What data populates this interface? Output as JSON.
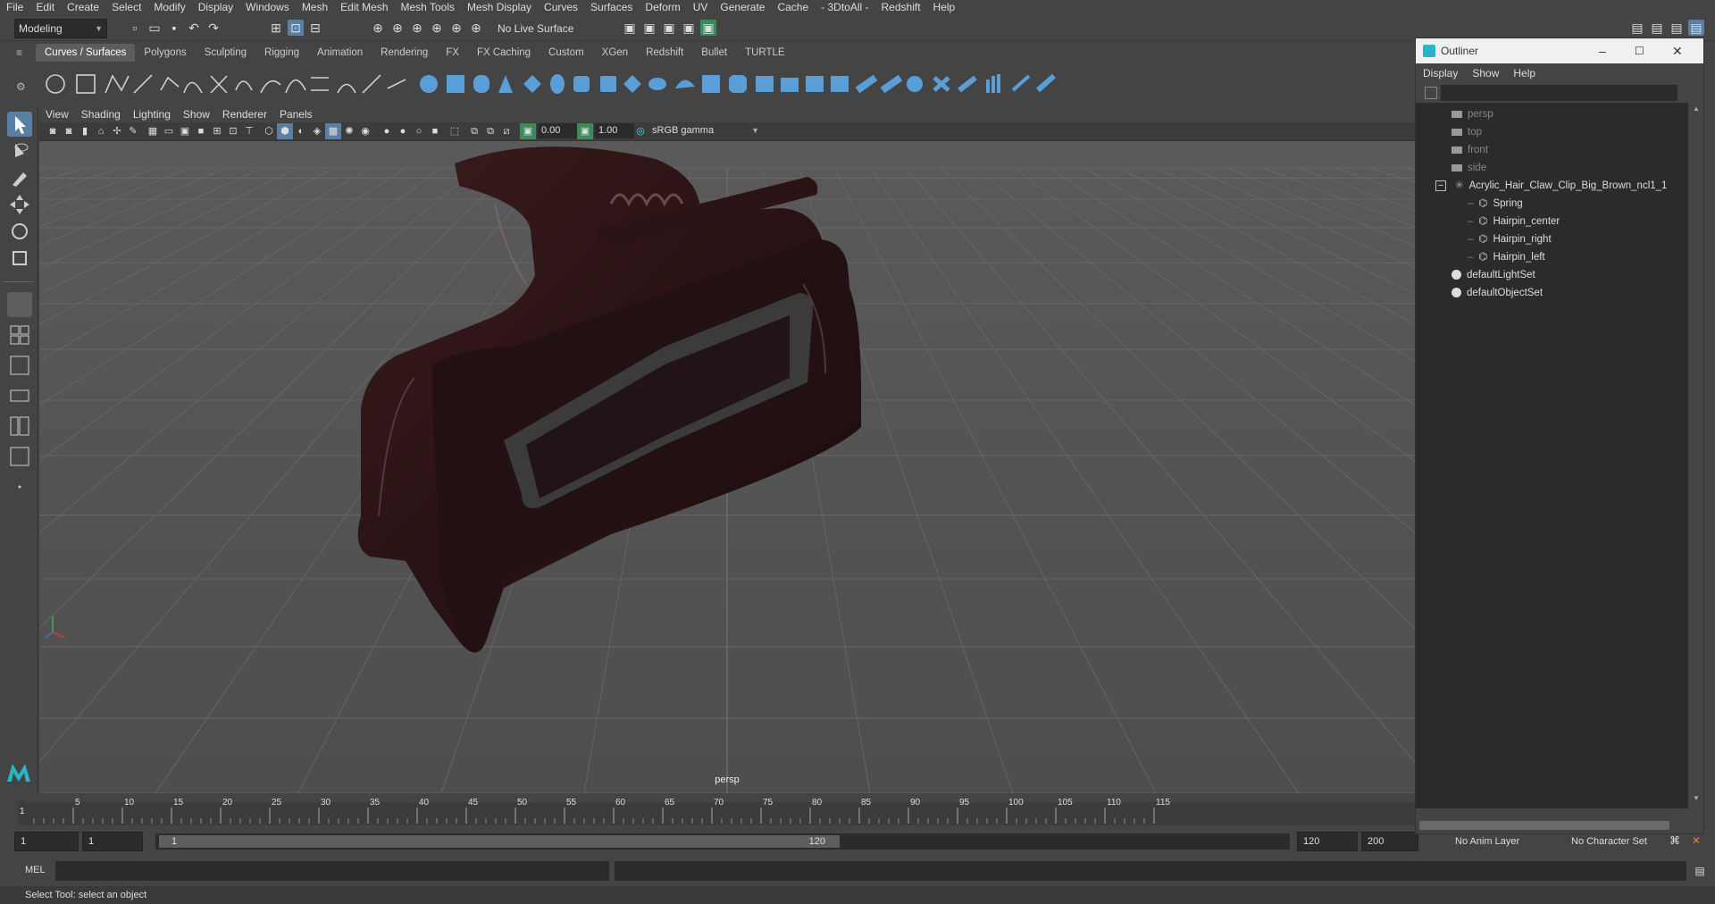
{
  "menubar": [
    "File",
    "Edit",
    "Create",
    "Select",
    "Modify",
    "Display",
    "Windows",
    "Mesh",
    "Edit Mesh",
    "Mesh Tools",
    "Mesh Display",
    "Curves",
    "Surfaces",
    "Deform",
    "UV",
    "Generate",
    "Cache",
    "- 3DtoAll -",
    "Redshift",
    "Help"
  ],
  "statusline": {
    "workspace": "Modeling",
    "live_surface": "No Live Surface"
  },
  "shelf_tabs": [
    "Curves / Surfaces",
    "Polygons",
    "Sculpting",
    "Rigging",
    "Animation",
    "Rendering",
    "FX",
    "FX Caching",
    "Custom",
    "XGen",
    "Redshift",
    "Bullet",
    "TURTLE"
  ],
  "shelf_active": "Curves / Surfaces",
  "viewport": {
    "menu": [
      "View",
      "Shading",
      "Lighting",
      "Show",
      "Renderer",
      "Panels"
    ],
    "exposure": "0.00",
    "gamma": "1.00",
    "color_space": "sRGB gamma",
    "camera_label": "persp",
    "model_color": "#2a1214",
    "grid_color": "#6a6a6a"
  },
  "timeline": {
    "ticks": [
      "5",
      "10",
      "15",
      "20",
      "25",
      "30",
      "35",
      "40",
      "45",
      "50",
      "55",
      "60",
      "65",
      "70",
      "75",
      "80",
      "85",
      "90",
      "95",
      "100",
      "105",
      "110",
      "115"
    ],
    "current_frame": "1"
  },
  "range": {
    "start": "1",
    "anim_start": "1",
    "slider_start": "1",
    "slider_end": "120",
    "end": "120",
    "anim_end": "200",
    "anim_layer": "No Anim Layer",
    "char_set": "No Character Set"
  },
  "cmdline": {
    "label": "MEL"
  },
  "helpline": "Select Tool: select an object",
  "outliner": {
    "title": "Outliner",
    "menu": [
      "Display",
      "Show",
      "Help"
    ],
    "cameras": [
      "persp",
      "top",
      "front",
      "side"
    ],
    "group": "Acrylic_Hair_Claw_Clip_Big_Brown_ncl1_1",
    "children": [
      "Spring",
      "Hairpin_center",
      "Hairpin_right",
      "Hairpin_left"
    ],
    "sets": [
      "defaultLightSet",
      "defaultObjectSet"
    ]
  },
  "accent_color": "#5a7fa5"
}
